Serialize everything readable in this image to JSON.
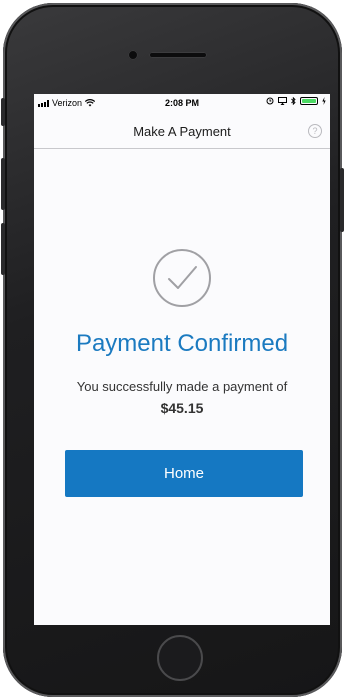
{
  "status_bar": {
    "carrier": "Verizon",
    "time": "2:08 PM",
    "battery_level": 1.0
  },
  "nav": {
    "title": "Make A Payment",
    "help_label": "?"
  },
  "confirmation": {
    "title": "Payment Confirmed",
    "message": "You successfully made a payment of",
    "amount": "$45.15"
  },
  "actions": {
    "home_label": "Home"
  },
  "colors": {
    "accent": "#1578c2",
    "title_blue": "#1b7ac0",
    "check_gray": "#a0a0a4"
  },
  "icons": {
    "signal": "signal-bars-icon",
    "wifi": "wifi-icon",
    "alarm": "alarm-icon",
    "airplay": "screen-mirroring-icon",
    "bluetooth": "bluetooth-icon",
    "battery": "battery-icon",
    "help": "help-icon",
    "check": "checkmark-circle-icon"
  }
}
